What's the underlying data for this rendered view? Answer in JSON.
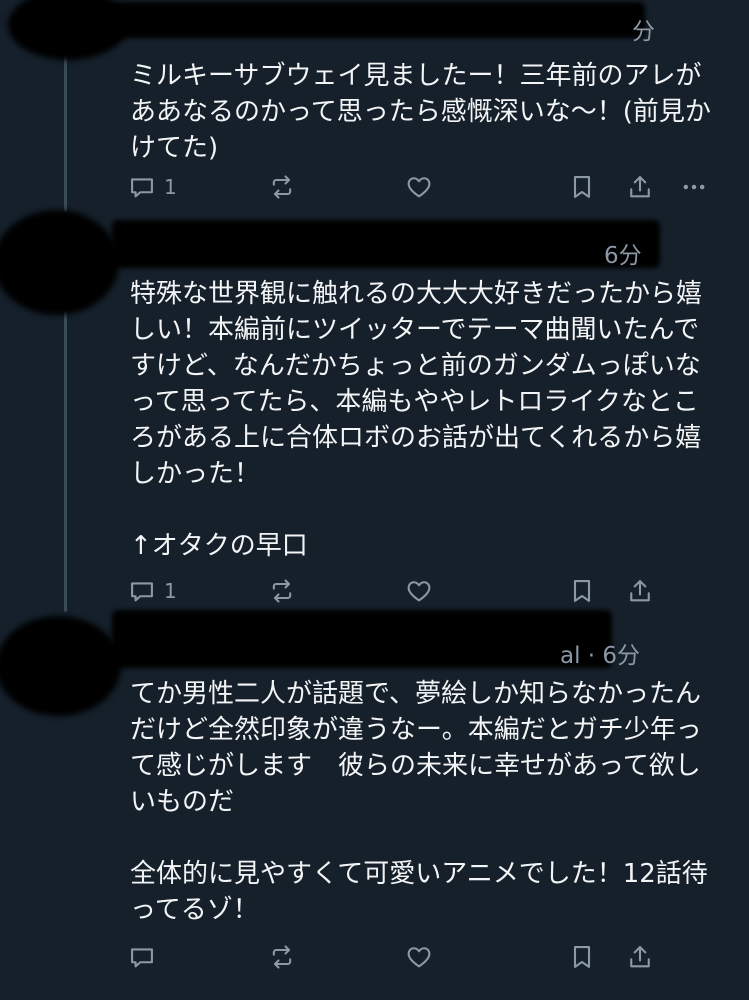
{
  "tweets": [
    {
      "time": "分",
      "paragraphs": [
        "ミルキーサブウェイ見ましたー！三年前のアレがああなるのかって思ったら感慨深いな〜！(前見かけてた)"
      ],
      "reply_count": "1"
    },
    {
      "time": "6分",
      "paragraphs": [
        "特殊な世界観に触れるの大大大好きだったから嬉しい！本編前にツイッターでテーマ曲聞いたんですけど、なんだかちょっと前のガンダムっぽいなって思ってたら、本編もややレトロライクなところがある上に合体ロボのお話が出てくれるから嬉しかった！",
        "↑オタクの早口"
      ],
      "reply_count": "1"
    },
    {
      "time": "al · 6分",
      "paragraphs": [
        "てか男性二人が話題で、夢絵しか知らなかったんだけど全然印象が違うなー。本編だとガチ少年って感じがします　彼らの未来に幸せがあって欲しいものだ",
        "全体的に見やすくて可愛いアニメでした！12話待ってるゾ！"
      ],
      "reply_count": ""
    }
  ],
  "icons": {
    "reply": "reply-icon",
    "retweet": "retweet-icon",
    "like": "heart-icon",
    "bookmark": "bookmark-icon",
    "share": "share-icon",
    "more": "more-icon"
  },
  "colors": {
    "background": "#15202b",
    "text": "#f2f4f5",
    "secondary": "#8b98a5",
    "thread_line": "#3a4a57"
  }
}
